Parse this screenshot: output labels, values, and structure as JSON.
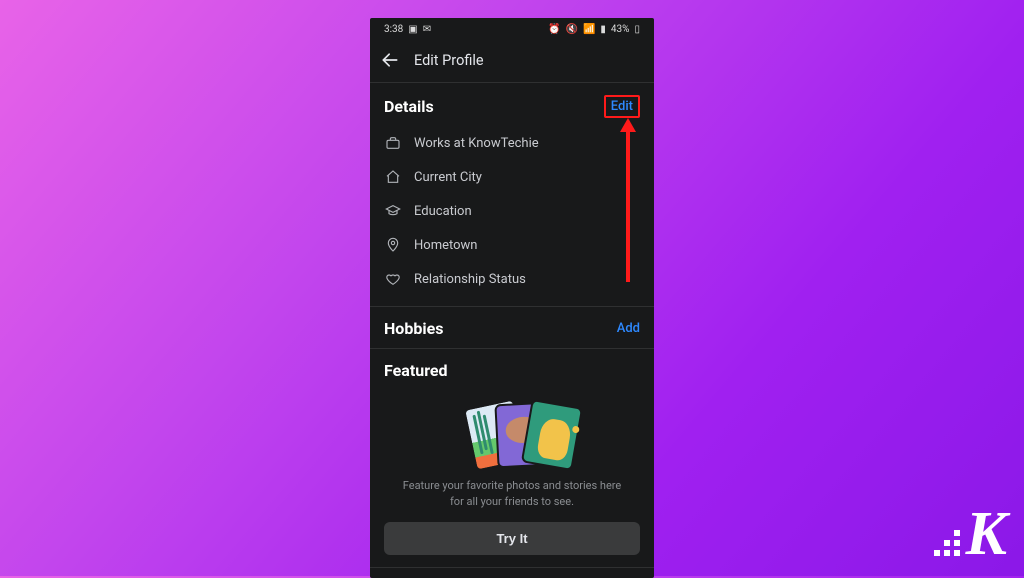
{
  "statusbar": {
    "time": "3:38",
    "battery": "43%"
  },
  "topbar": {
    "title": "Edit Profile"
  },
  "details": {
    "title": "Details",
    "edit_label": "Edit",
    "items": [
      {
        "label": "Works at KnowTechie"
      },
      {
        "label": "Current City"
      },
      {
        "label": "Education"
      },
      {
        "label": "Hometown"
      },
      {
        "label": "Relationship Status"
      }
    ]
  },
  "hobbies": {
    "title": "Hobbies",
    "action_label": "Add"
  },
  "featured": {
    "title": "Featured",
    "caption_line1": "Feature your favorite photos and stories here",
    "caption_line2": "for all your friends to see.",
    "tryit_label": "Try It"
  },
  "watermark": {
    "letter": "K"
  },
  "colors": {
    "accent_link": "#2e89ff",
    "highlight": "#ff1a1a"
  }
}
